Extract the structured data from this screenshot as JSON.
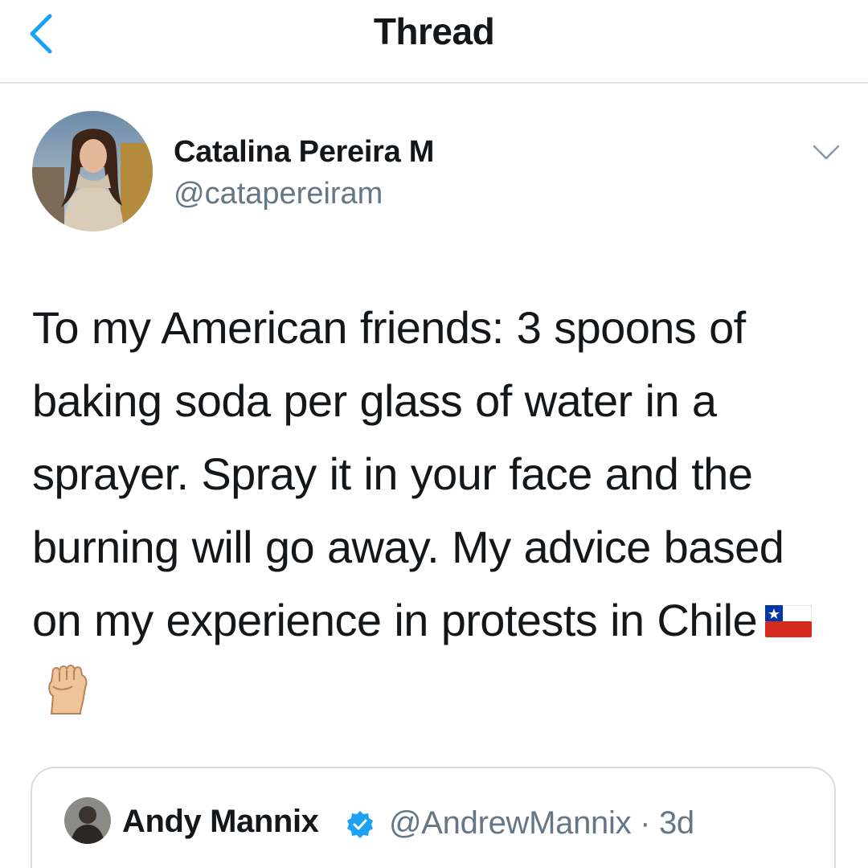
{
  "nav": {
    "title": "Thread",
    "back_icon": "chevron-left-icon"
  },
  "tweet": {
    "author": {
      "name": "Catalina Pereira M",
      "handle": "@catapereiram"
    },
    "text": "To my American friends: 3 spoons of baking soda per glass of water in a sprayer. Spray it in your face and the burning will go away. My advice based on my experience in protests in Chile",
    "emojis": [
      "chile-flag-icon",
      "raised-fist-icon"
    ]
  },
  "quoted_tweet": {
    "author": {
      "name": "Andy Mannix",
      "handle": "@AndrewMannix",
      "time": "· 3d"
    },
    "verified": true
  },
  "colors": {
    "accent": "#1da1f2",
    "text": "#14171a",
    "secondary": "#657786",
    "divider": "#e1e8ed"
  }
}
